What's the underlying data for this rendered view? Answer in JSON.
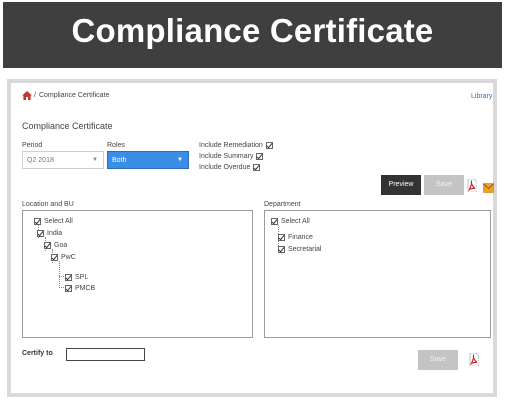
{
  "banner": {
    "title": "Compliance Certificate"
  },
  "breadcrumb": {
    "separator": "/",
    "current": "Compliance Certificate"
  },
  "header": {
    "library_link": "Library"
  },
  "form": {
    "heading": "Compliance Certificate",
    "period": {
      "label": "Period",
      "value": "Q2 2018"
    },
    "roles": {
      "label": "Roles",
      "value": "Both"
    },
    "options": [
      {
        "label": "Include Remediation",
        "checked": true
      },
      {
        "label": "Include Summary",
        "checked": true
      },
      {
        "label": "Include Overdue",
        "checked": true
      }
    ]
  },
  "toolbar": {
    "preview_label": "Preview",
    "save_label": "Save"
  },
  "location": {
    "label": "Location and BU",
    "items": [
      "Select All",
      "India",
      "Goa",
      "PwC",
      "SPL",
      "PMCB"
    ]
  },
  "department": {
    "label": "Department",
    "items": [
      "Select All",
      "Finance",
      "Secretarial"
    ]
  },
  "certify": {
    "label": "Certify to",
    "value": ""
  },
  "footer": {
    "save_label": "Save"
  },
  "icons": {
    "home": "home-icon",
    "pdf": "pdf-icon",
    "email": "mail-icon",
    "dropdown": "chevron-down-icon",
    "checkbox": "checkbox-checked-icon"
  },
  "colors": {
    "accent_blue": "#3a8ee6",
    "banner": "#3f3f3f",
    "pdf_red": "#d11a1a",
    "home_red": "#c0392b",
    "mail_orange": "#f0a21a"
  }
}
